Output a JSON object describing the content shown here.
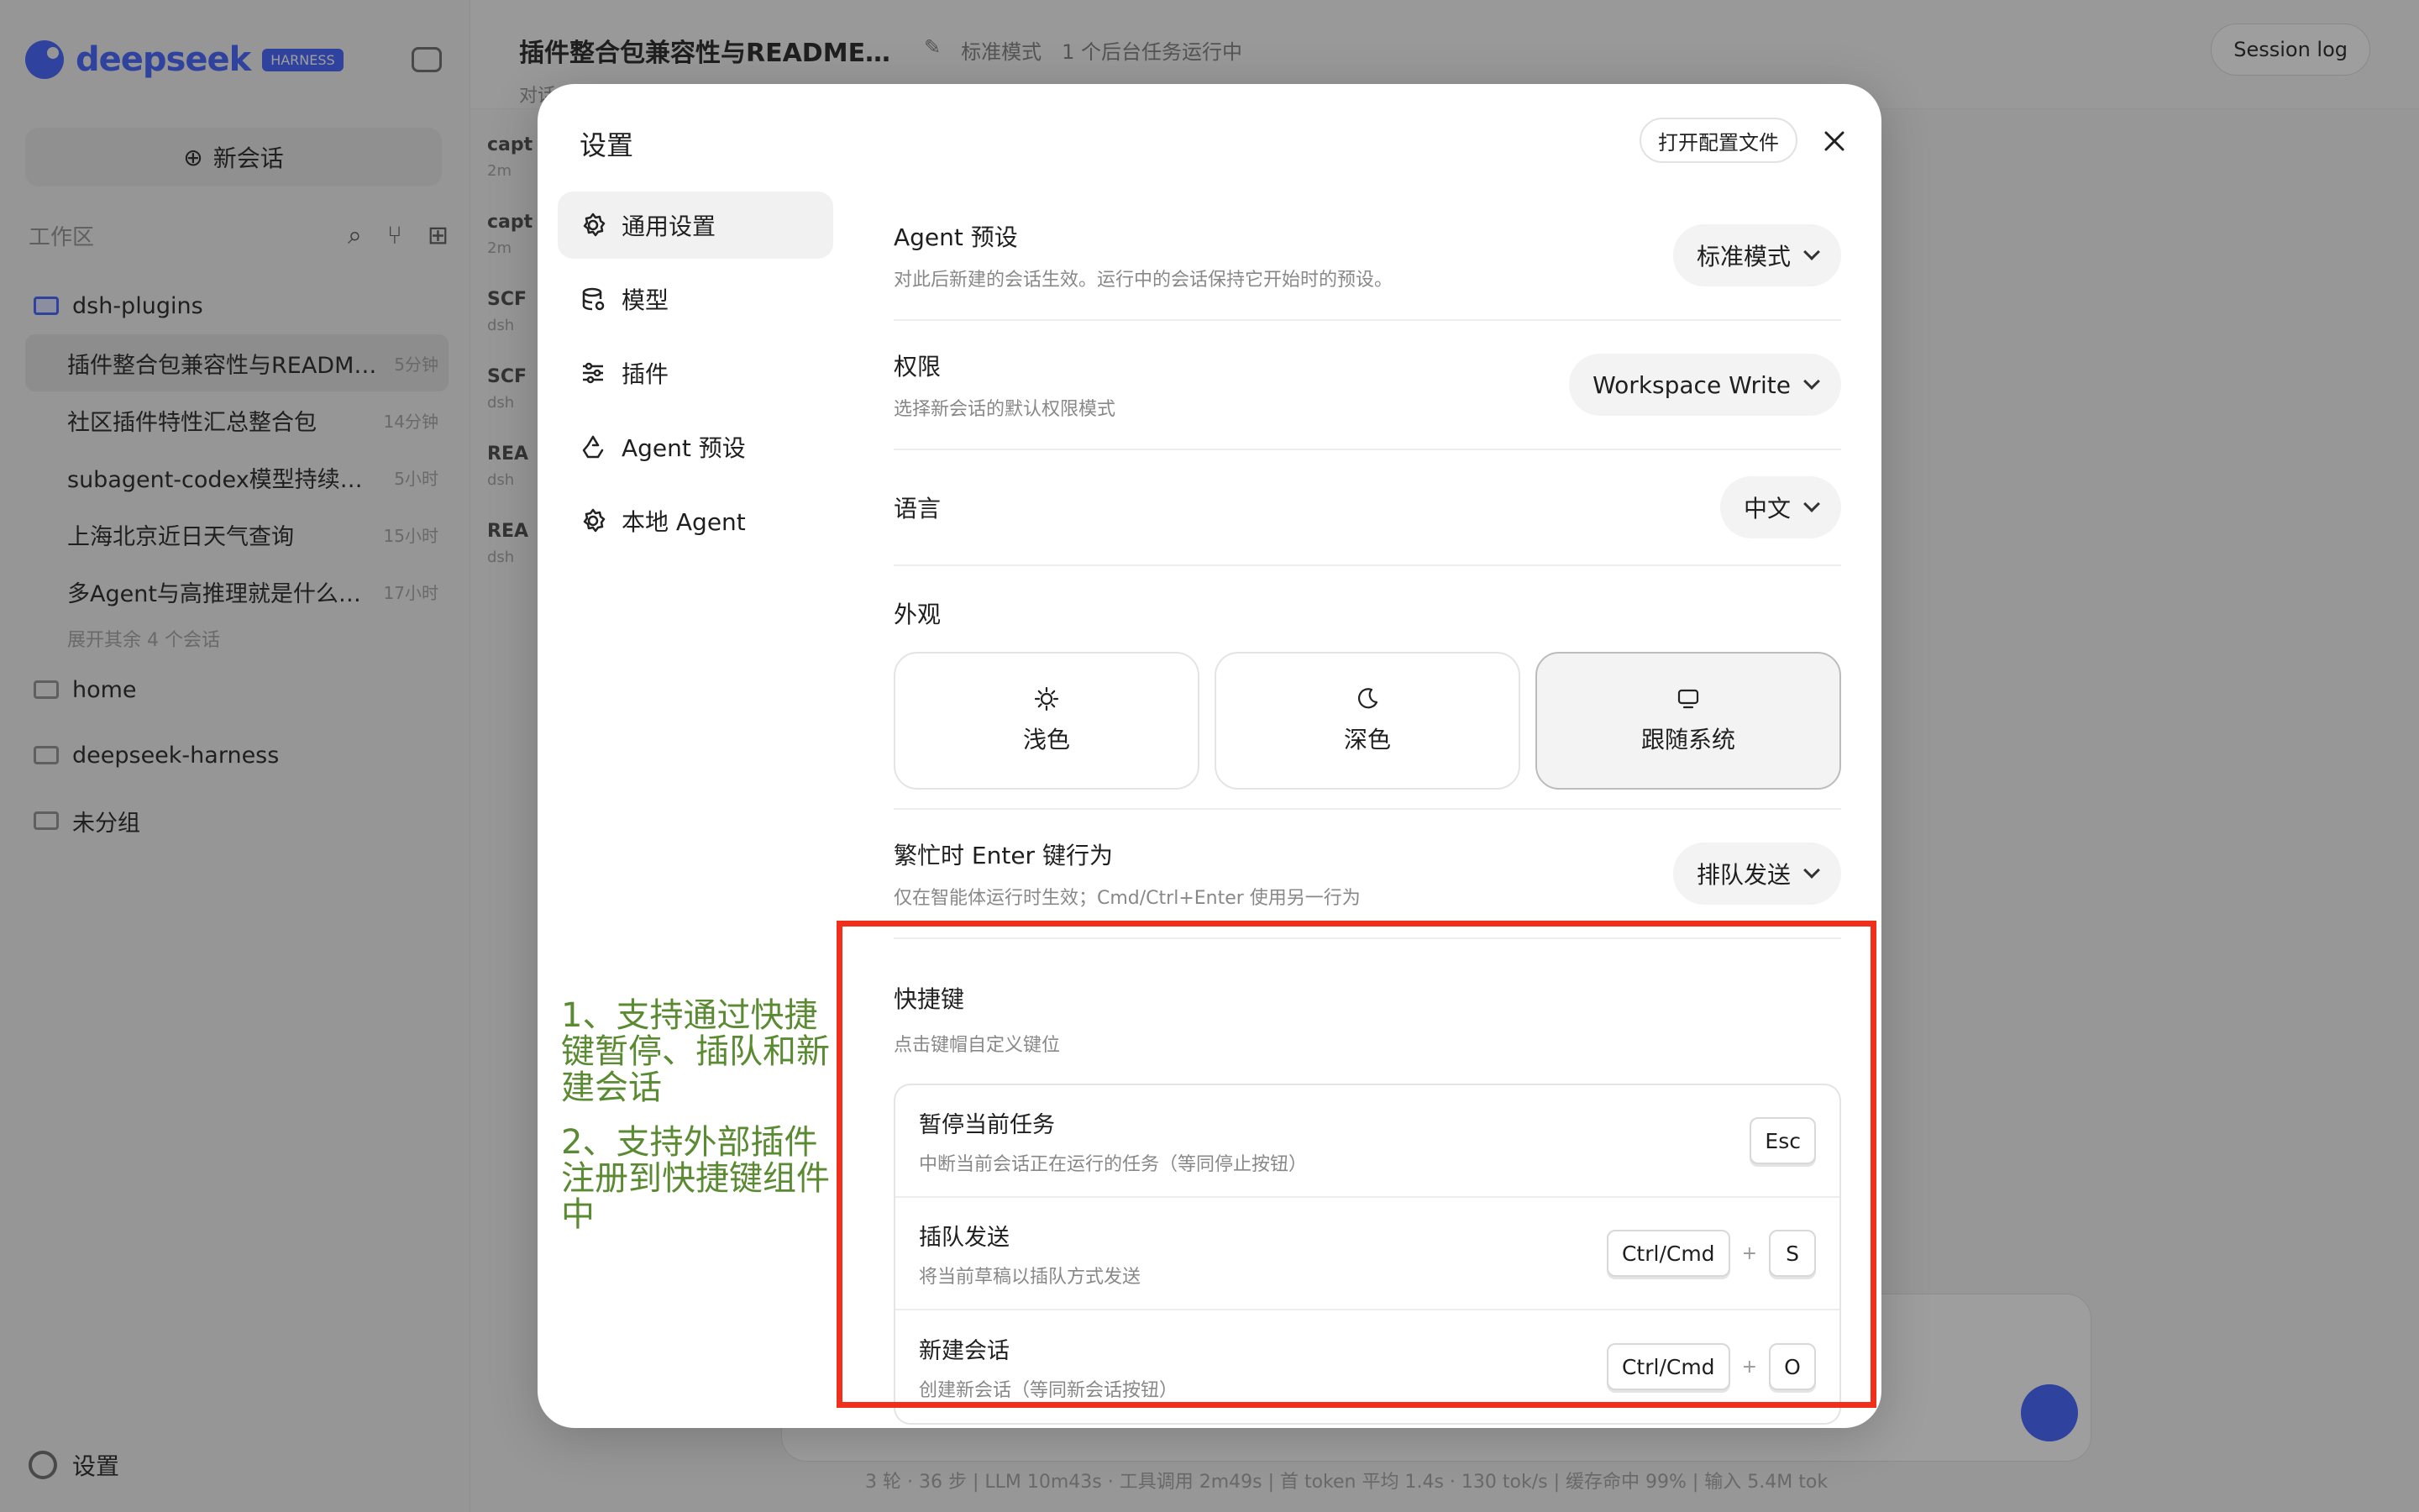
{
  "background": {
    "logo_text": "deepseek",
    "logo_badge": "HARNESS",
    "new_chat_label": "新会话",
    "workspace_label": "工作区",
    "projects": [
      {
        "name": "dsh-plugins",
        "highlight": true
      },
      {
        "name": "home"
      },
      {
        "name": "deepseek-harness"
      },
      {
        "name": "未分组"
      }
    ],
    "sessions": [
      {
        "title": "插件整合包兼容性与READM…",
        "time": "5分钟"
      },
      {
        "title": "社区插件特性汇总整合包",
        "time": "14分钟"
      },
      {
        "title": "subagent-codex模型持续…",
        "time": "5小时"
      },
      {
        "title": "上海北京近日天气查询",
        "time": "15小时"
      },
      {
        "title": "多Agent与高推理就是什么…",
        "time": "17小时"
      }
    ],
    "more_sessions": "展开其余 4 个会话",
    "sidebar_settings": "设置",
    "topbar_title": "插件整合包兼容性与README…",
    "topbar_mode": "标准模式",
    "topbar_tasks": "1 个后台任务运行中",
    "topbar_tab": "对话",
    "session_log": "Session log",
    "list_items": [
      {
        "t": "capt",
        "s": "2m"
      },
      {
        "t": "capt",
        "s": "2m"
      },
      {
        "t": "SCF",
        "s": "dsh"
      },
      {
        "t": "SCF",
        "s": "dsh"
      },
      {
        "t": "REA",
        "s": "dsh"
      },
      {
        "t": "REA",
        "s": "dsh"
      }
    ],
    "status_bar": "3 轮 · 36 步 | LLM 10m43s · 工具调用 2m49s | 首 token 平均 1.4s · 130 tok/s | 缓存命中 99% | 输入 5.4M tok"
  },
  "modal": {
    "title": "设置",
    "open_config_label": "打开配置文件",
    "nav": [
      {
        "label": "通用设置",
        "icon": "gear-icon",
        "active": true
      },
      {
        "label": "模型",
        "icon": "database-icon"
      },
      {
        "label": "插件",
        "icon": "sliders-icon"
      },
      {
        "label": "Agent 预设",
        "icon": "recycle-icon"
      },
      {
        "label": "本地 Agent",
        "icon": "gear-icon"
      }
    ],
    "agent_preset": {
      "label": "Agent 预设",
      "desc": "对此后新建的会话生效。运行中的会话保持它开始时的预设。",
      "value": "标准模式"
    },
    "permission": {
      "label": "权限",
      "desc": "选择新会话的默认权限模式",
      "value": "Workspace Write"
    },
    "language": {
      "label": "语言",
      "value": "中文"
    },
    "appearance": {
      "label": "外观",
      "options": [
        {
          "label": "浅色",
          "icon": "sun-icon"
        },
        {
          "label": "深色",
          "icon": "moon-icon"
        },
        {
          "label": "跟随系统",
          "icon": "monitor-icon",
          "selected": true
        }
      ]
    },
    "busy_enter": {
      "label": "繁忙时 Enter 键行为",
      "desc": "仅在智能体运行时生效；Cmd/Ctrl+Enter 使用另一行为",
      "value": "排队发送"
    },
    "shortcuts": {
      "label": "快捷键",
      "desc": "点击键帽自定义键位",
      "items": [
        {
          "name": "暂停当前任务",
          "desc": "中断当前会话正在运行的任务（等同停止按钮）",
          "keys": [
            "Esc"
          ]
        },
        {
          "name": "插队发送",
          "desc": "将当前草稿以插队方式发送",
          "keys": [
            "Ctrl/Cmd",
            "S"
          ]
        },
        {
          "name": "新建会话",
          "desc": "创建新会话（等同新会话按钮）",
          "keys": [
            "Ctrl/Cmd",
            "O"
          ]
        }
      ],
      "plus": "+"
    }
  },
  "annotation": {
    "line1": "1、支持通过快捷键暂停、插队和新建会话",
    "line2": "2、支持外部插件注册到快捷键组件中",
    "color": "#5a8a32",
    "box_color": "#f0301a"
  }
}
